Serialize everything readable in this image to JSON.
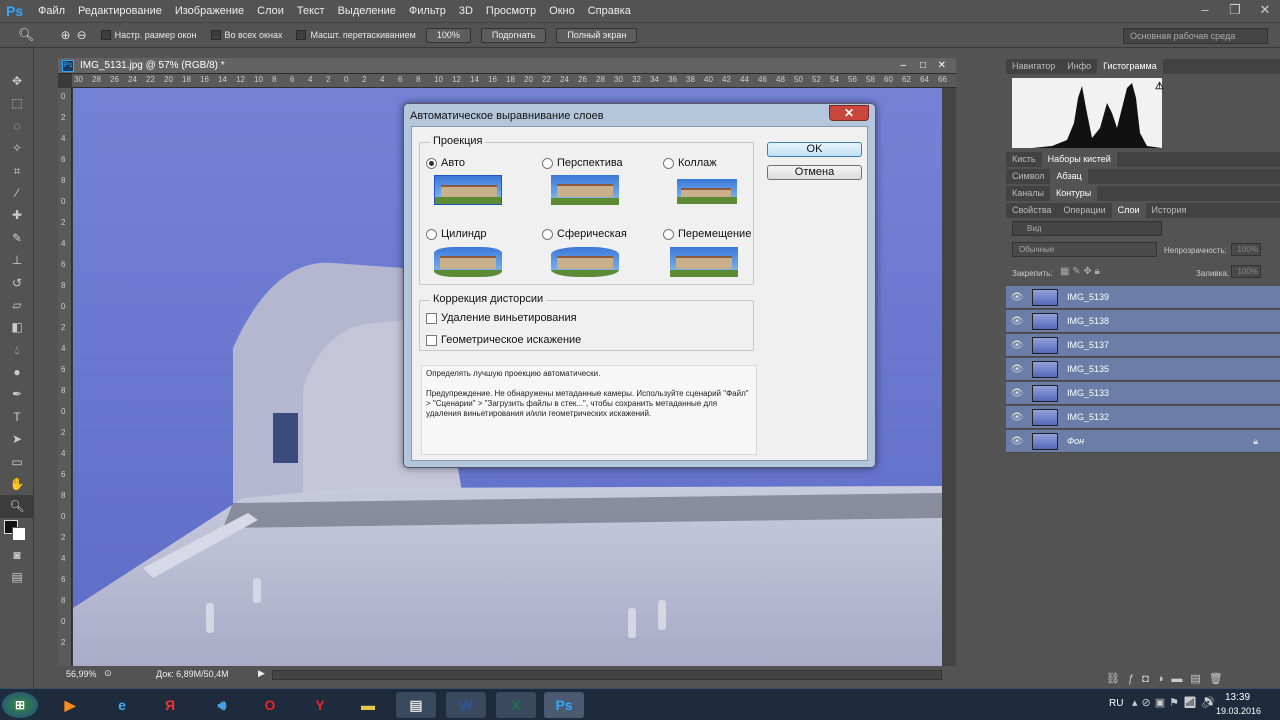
{
  "menu": {
    "logo": "Ps",
    "items": [
      "Файл",
      "Редактирование",
      "Изображение",
      "Слои",
      "Текст",
      "Выделение",
      "Фильтр",
      "3D",
      "Просмотр",
      "Окно",
      "Справка"
    ]
  },
  "options": {
    "resize_windows": "Настр. размер окон",
    "all_windows": "Во всех окнах",
    "scrubby_zoom": "Масшт. перетаскиванием",
    "zoom_100": "100%",
    "fit": "Подогнать",
    "fullscreen": "Полный экран",
    "workspace": "Основная рабочая среда"
  },
  "document": {
    "tab_title": "IMG_5131.jpg @ 57% (RGB/8) *",
    "zoom": "56,99%",
    "doc_size": "Док: 6,89M/50,4M",
    "ruler_labels": [
      "30",
      "28",
      "26",
      "24",
      "22",
      "20",
      "18",
      "16",
      "14",
      "12",
      "10",
      "8",
      "6",
      "4",
      "2",
      "0",
      "2",
      "4",
      "6",
      "8",
      "10",
      "12",
      "14",
      "16",
      "18",
      "20",
      "22",
      "24",
      "26",
      "28",
      "30",
      "32",
      "34",
      "36",
      "38",
      "40",
      "42",
      "44",
      "46",
      "48",
      "50",
      "52",
      "54",
      "56",
      "58",
      "60",
      "62",
      "64",
      "66"
    ],
    "vruler_labels": [
      "0",
      "2",
      "4",
      "6",
      "8",
      "0",
      "2",
      "4",
      "6",
      "8",
      "0",
      "2",
      "4",
      "6",
      "8",
      "0",
      "2",
      "4",
      "6",
      "8",
      "0",
      "2",
      "4",
      "6",
      "8",
      "0",
      "2"
    ]
  },
  "dialog": {
    "title": "Автоматическое выравнивание слоев",
    "close": "✕",
    "projection_label": "Проекция",
    "options": [
      {
        "label": "Авто",
        "selected": true
      },
      {
        "label": "Перспектива",
        "selected": false
      },
      {
        "label": "Коллаж",
        "selected": false
      },
      {
        "label": "Цилиндр",
        "selected": false
      },
      {
        "label": "Сферическая",
        "selected": false
      },
      {
        "label": "Перемещение",
        "selected": false
      }
    ],
    "distortion_label": "Коррекция дисторсии",
    "vignette": "Удаление виньетирования",
    "geometric": "Геометрическое искажение",
    "ok": "OK",
    "cancel": "Отмена",
    "info_line1": "Определять лучшую проекцию автоматически.",
    "info_line2": "Предупреждение. Не обнаружены метаданные камеры. Используйте сценарий \"Файл\" > \"Сценарии\" > \"Загрузить файлы в стек...\", чтобы сохранить метаданные для удаления виньетирования и/или геометрических искажений."
  },
  "panels": {
    "tabs1": [
      "Навигатор",
      "Инфо",
      "Гистограмма"
    ],
    "tabs2": [
      "Кисть",
      "Наборы кистей"
    ],
    "tabs3": [
      "Символ",
      "Абзац"
    ],
    "tabs4": [
      "Каналы",
      "Контуры"
    ],
    "tabs5": [
      "Свойства",
      "Операции",
      "Слои",
      "История"
    ],
    "kind": "Вид",
    "blend": "Обычные",
    "opacity_label": "Непрозрачность:",
    "opacity_value": "100%",
    "lock_label": "Закрепить:",
    "fill_label": "Заливка:",
    "fill_value": "100%",
    "layers": [
      "IMG_5139",
      "IMG_5138",
      "IMG_5137",
      "IMG_5135",
      "IMG_5133",
      "IMG_5132",
      "Фон"
    ]
  },
  "taskbar": {
    "lang": "RU",
    "time": "13:39",
    "date": "19.03.2016"
  }
}
